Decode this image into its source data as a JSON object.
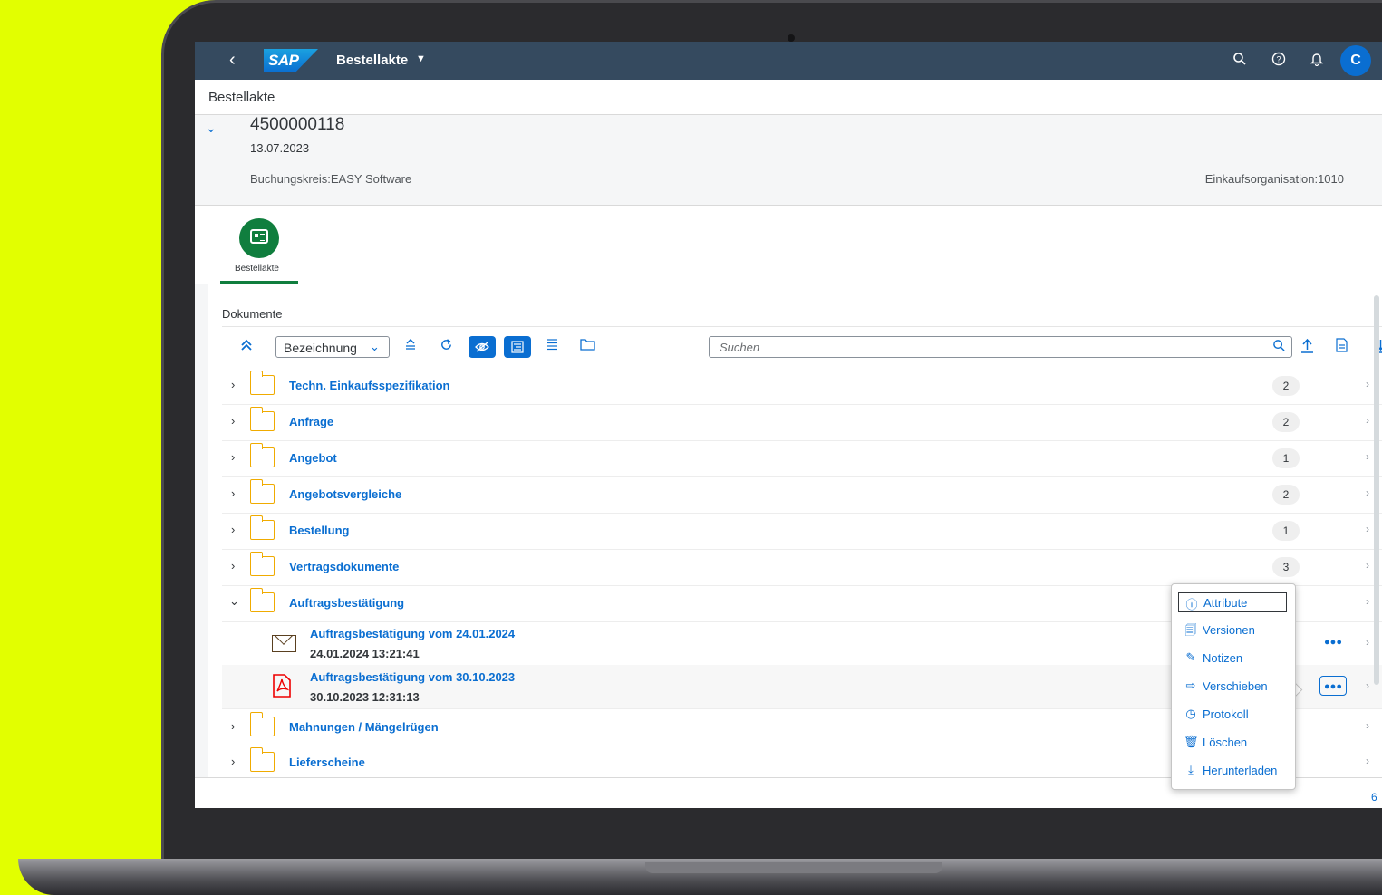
{
  "shell": {
    "title": "Bestellakte",
    "avatar": "C"
  },
  "page_title": "Bestellakte",
  "object": {
    "number": "4500000118",
    "date": "13.07.2023",
    "buchungskreis": "Buchungskreis:EASY Software",
    "einkaufsorganisation": "Einkaufsorganisation:1010"
  },
  "tab": {
    "label": "Bestellakte"
  },
  "documents": {
    "title": "Dokumente",
    "select_value": "Bezeichnung",
    "search_placeholder": "Suchen",
    "folders": [
      {
        "name": "Techn. Einkaufsspezifikation",
        "count": "2"
      },
      {
        "name": "Anfrage",
        "count": "2"
      },
      {
        "name": "Angebot",
        "count": "1"
      },
      {
        "name": "Angebotsvergleiche",
        "count": "2"
      },
      {
        "name": "Bestellung",
        "count": "1"
      },
      {
        "name": "Vertragsdokumente",
        "count": "3"
      },
      {
        "name": "Auftragsbestätigung",
        "count": ""
      }
    ],
    "sub_items": [
      {
        "title": "Auftragsbestätigung vom 24.01.2024",
        "date": "24.01.2024 13:21:41",
        "icon": "mail-icon"
      },
      {
        "title": "Auftragsbestätigung vom 30.10.2023",
        "date": "30.10.2023 12:31:13",
        "icon": "pdf-icon"
      }
    ],
    "folders_after": [
      {
        "name": "Mahnungen / Mängelrügen"
      },
      {
        "name": "Lieferscheine"
      }
    ]
  },
  "context_menu": {
    "items": [
      {
        "label": "Attribute",
        "icon": "info-icon"
      },
      {
        "label": "Versionen",
        "icon": "versions-icon"
      },
      {
        "label": "Notizen",
        "icon": "notes-icon"
      },
      {
        "label": "Verschieben",
        "icon": "move-icon"
      },
      {
        "label": "Protokoll",
        "icon": "history-icon"
      },
      {
        "label": "Löschen",
        "icon": "delete-icon"
      },
      {
        "label": "Herunterladen",
        "icon": "download-icon"
      }
    ]
  },
  "footer": {
    "text": "6"
  },
  "colors": {
    "shell": "#354a5f",
    "accent": "#0a6ed1",
    "folder": "#f0ab00",
    "tab": "#107e3e",
    "background": "#e2ff00"
  }
}
